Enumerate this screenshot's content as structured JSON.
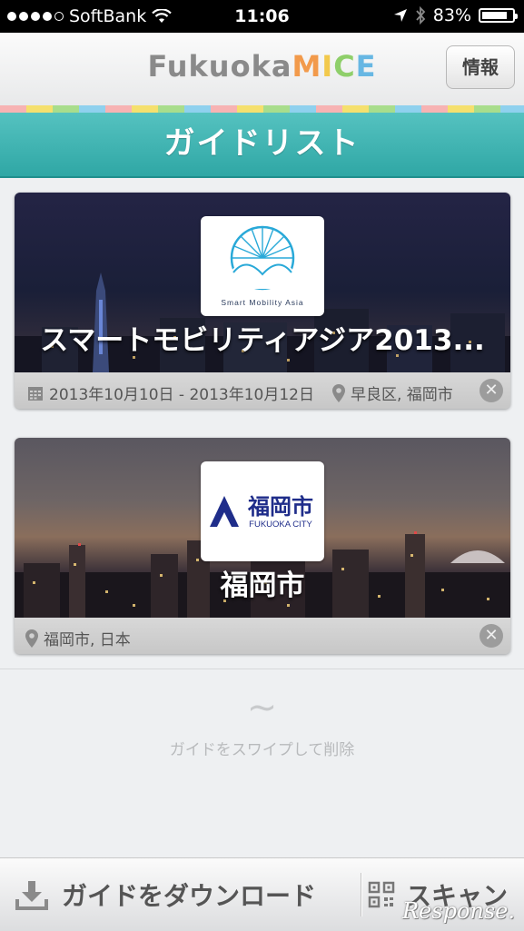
{
  "status_bar": {
    "carrier": "SoftBank",
    "time": "11:06",
    "battery": "83%",
    "battery_level": 0.83
  },
  "nav": {
    "logo_part1": "Fukuoka",
    "logo_m": "M",
    "logo_i": "I",
    "logo_c": "C",
    "logo_e": "E",
    "info_button": "情報"
  },
  "header": {
    "title": "ガイドリスト"
  },
  "guides": [
    {
      "title": "スマートモビリティアジア2013...",
      "date": "2013年10月10日 - 2013年10月12日",
      "location": "早良区, 福岡市",
      "logo_text": "Smart Mobility Asia",
      "icon_calendar": "calendar-icon",
      "icon_location": "pin-icon"
    },
    {
      "title": "福岡市",
      "location": "福岡市, 日本",
      "logo_text_jp": "福岡市",
      "logo_text_en": "FUKUOKA CITY"
    }
  ],
  "empty_hint": {
    "tilde": "~",
    "text": "ガイドをスワイプして削除"
  },
  "toolbar": {
    "download_label": "ガイドをダウンロード",
    "scan_label": "スキャン"
  },
  "watermark": "Response.",
  "colors": {
    "header_teal": "#3cb3b1",
    "logo_m": "#f29a4b",
    "logo_i": "#f2c94c",
    "logo_c": "#8fcf6a",
    "logo_e": "#67b7e3"
  }
}
